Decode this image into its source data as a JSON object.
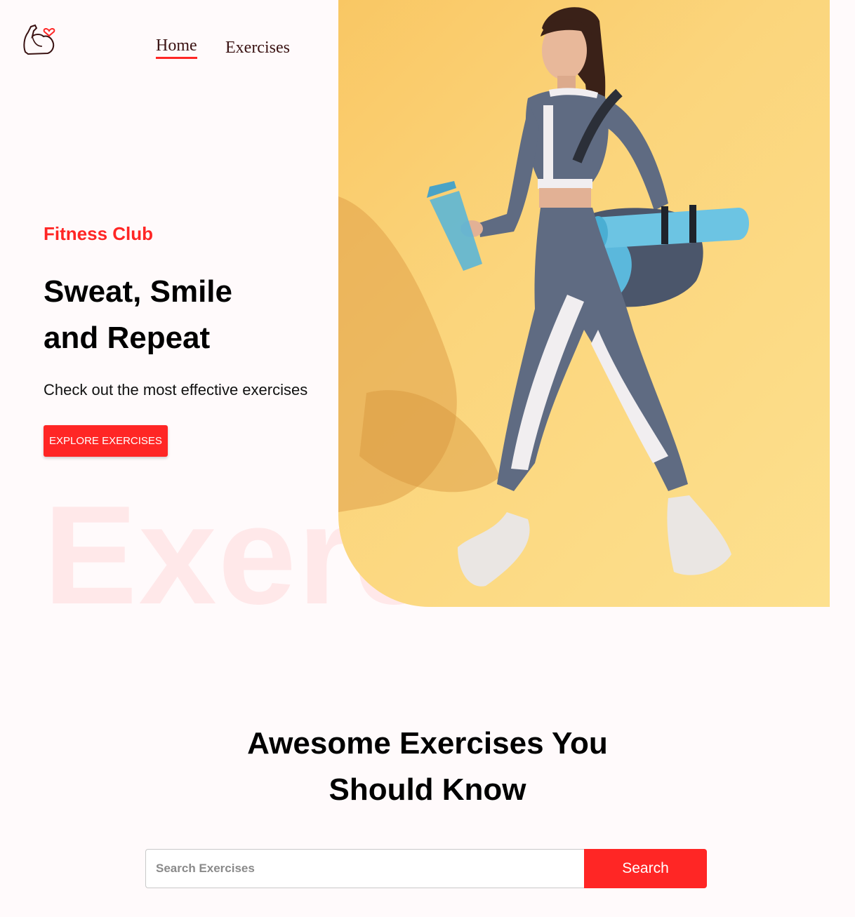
{
  "nav": {
    "logo_icon": "flexed-bicep-heart-icon",
    "home_label": "Home",
    "exercises_label": "Exercises"
  },
  "hero": {
    "kicker": "Fitness Club",
    "title_line1": "Sweat, Smile",
    "title_line2": "and Repeat",
    "subtitle": "Check out the most effective exercises",
    "cta_label": "EXPLORE EXERCISES",
    "background_word": "Exercises",
    "image_description_icon": "woman-walking-with-gym-bag-photo"
  },
  "search_section": {
    "title_line1": "Awesome Exercises You",
    "title_line2": "Should Know",
    "placeholder": "Search Exercises",
    "button_label": "Search"
  },
  "colors": {
    "accent": "#ff2625",
    "background": "#fffafb",
    "hero_bg": "#fbd57c"
  }
}
